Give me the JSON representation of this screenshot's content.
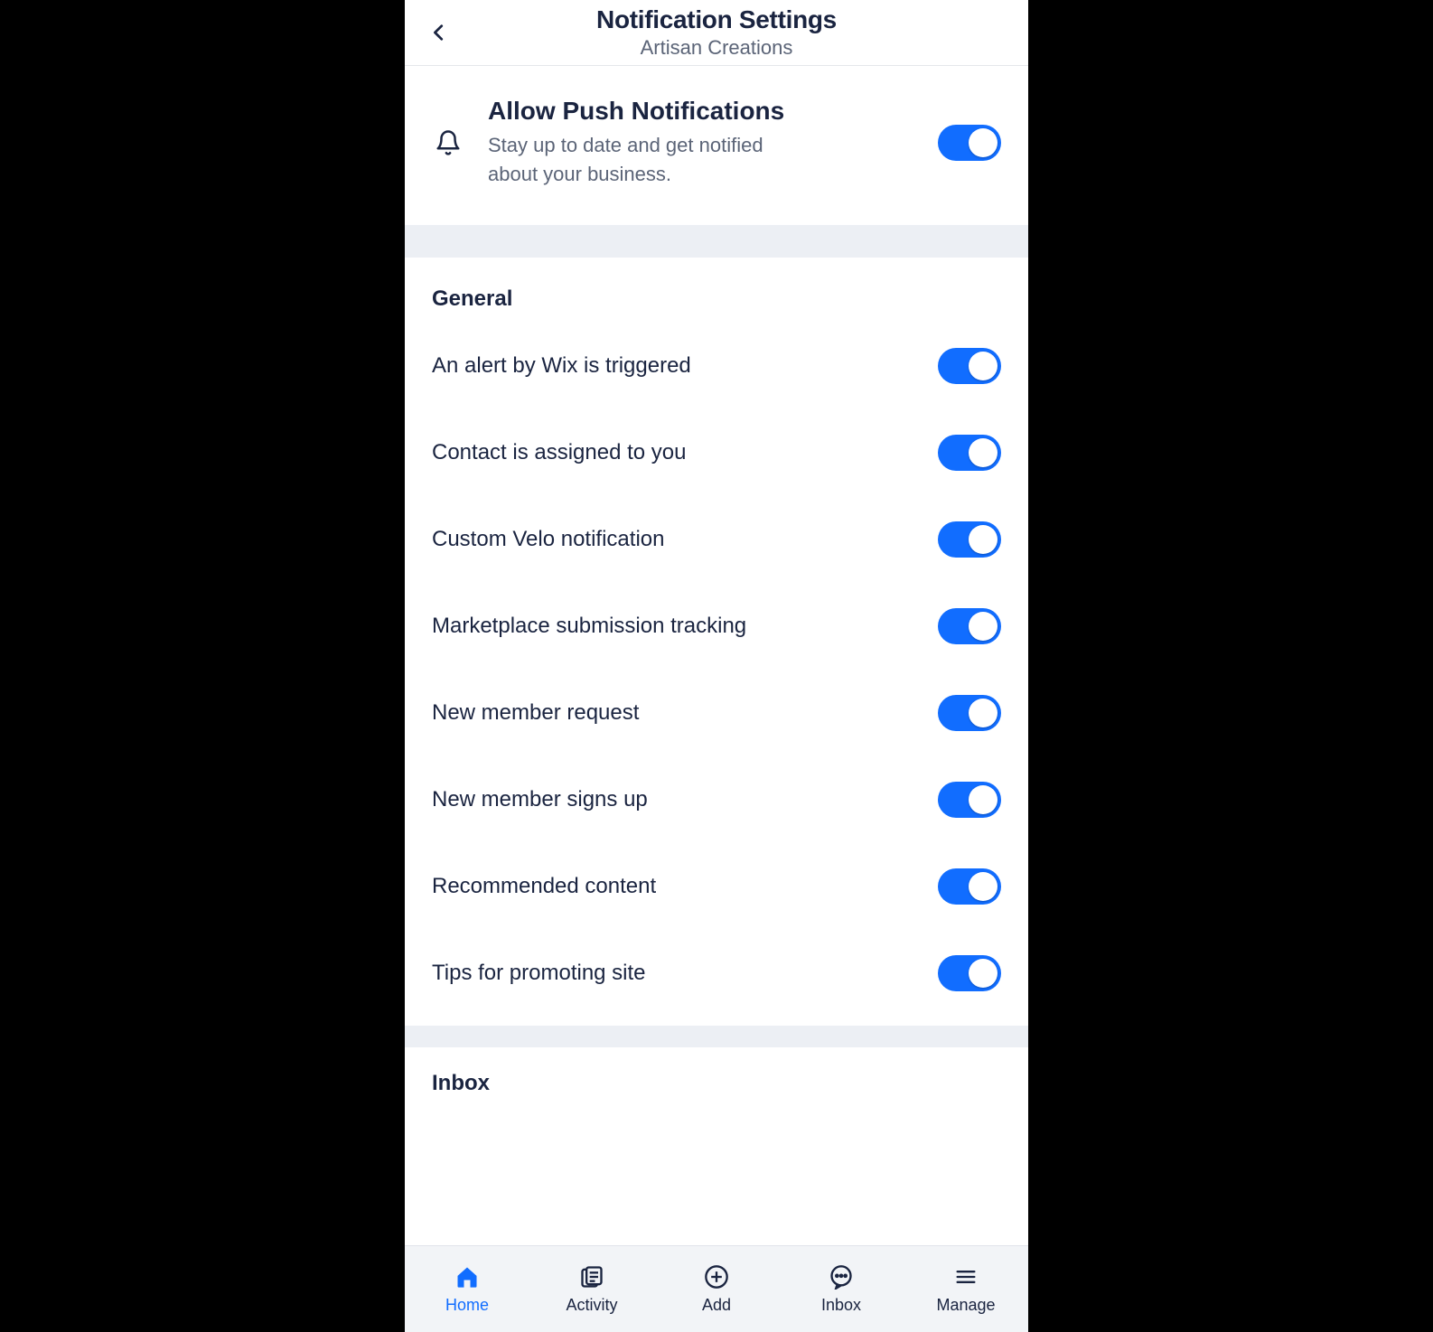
{
  "header": {
    "title": "Notification Settings",
    "subtitle": "Artisan Creations"
  },
  "push": {
    "title": "Allow Push Notifications",
    "description": "Stay up to date and get notified about your business.",
    "enabled": true
  },
  "sections": {
    "general": {
      "title": "General",
      "items": [
        {
          "label": "An alert by Wix is triggered",
          "enabled": true
        },
        {
          "label": "Contact is assigned to you",
          "enabled": true
        },
        {
          "label": "Custom Velo notification",
          "enabled": true
        },
        {
          "label": "Marketplace submission tracking",
          "enabled": true
        },
        {
          "label": "New member request",
          "enabled": true
        },
        {
          "label": "New member signs up",
          "enabled": true
        },
        {
          "label": "Recommended content",
          "enabled": true
        },
        {
          "label": "Tips for promoting site",
          "enabled": true
        }
      ]
    },
    "inbox": {
      "title": "Inbox"
    }
  },
  "bottomnav": {
    "items": [
      {
        "key": "home",
        "label": "Home",
        "active": true
      },
      {
        "key": "activity",
        "label": "Activity",
        "active": false
      },
      {
        "key": "add",
        "label": "Add",
        "active": false
      },
      {
        "key": "inbox",
        "label": "Inbox",
        "active": false
      },
      {
        "key": "manage",
        "label": "Manage",
        "active": false
      }
    ]
  },
  "colors": {
    "accent": "#116dff",
    "text": "#1a2440",
    "muted": "#5b6477",
    "divider": "#eceff4"
  }
}
